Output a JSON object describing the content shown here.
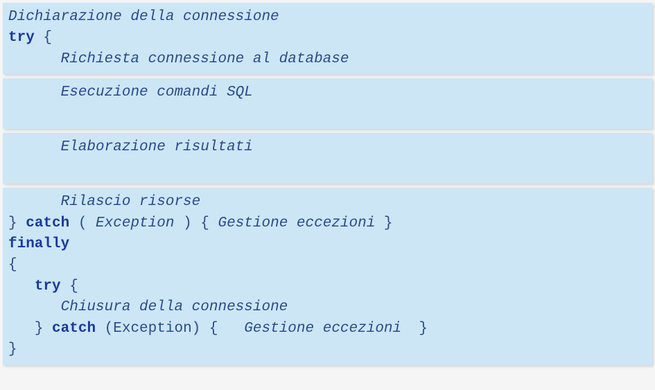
{
  "blocks": [
    {
      "lines": [
        {
          "indent": 0,
          "segments": [
            {
              "style": "comment",
              "text": "Dichiarazione della connessione"
            }
          ]
        },
        {
          "indent": 0,
          "segments": [
            {
              "style": "kw",
              "text": "try"
            },
            {
              "style": "plain",
              "text": " {"
            }
          ]
        },
        {
          "indent": 6,
          "segments": [
            {
              "style": "comment",
              "text": "Richiesta connessione al database"
            }
          ]
        }
      ]
    },
    {
      "lines": [
        {
          "indent": 6,
          "segments": [
            {
              "style": "comment",
              "text": "Esecuzione comandi SQL"
            }
          ]
        },
        {
          "indent": 0,
          "segments": [
            {
              "style": "plain",
              "text": " "
            }
          ]
        }
      ]
    },
    {
      "lines": [
        {
          "indent": 6,
          "segments": [
            {
              "style": "comment",
              "text": "Elaborazione risultati"
            }
          ]
        },
        {
          "indent": 0,
          "segments": [
            {
              "style": "plain",
              "text": " "
            }
          ]
        }
      ]
    },
    {
      "lines": [
        {
          "indent": 6,
          "segments": [
            {
              "style": "comment",
              "text": "Rilascio risorse"
            }
          ]
        },
        {
          "indent": 0,
          "segments": [
            {
              "style": "plain",
              "text": "} "
            },
            {
              "style": "kw",
              "text": "catch"
            },
            {
              "style": "plain",
              "text": " ( "
            },
            {
              "style": "comment",
              "text": "Exception"
            },
            {
              "style": "plain",
              "text": " ) { "
            },
            {
              "style": "comment",
              "text": "Gestione eccezioni"
            },
            {
              "style": "plain",
              "text": " }"
            }
          ]
        },
        {
          "indent": 0,
          "segments": [
            {
              "style": "kw",
              "text": "finally"
            }
          ]
        },
        {
          "indent": 0,
          "segments": [
            {
              "style": "plain",
              "text": "{"
            }
          ]
        },
        {
          "indent": 3,
          "segments": [
            {
              "style": "kw",
              "text": "try"
            },
            {
              "style": "plain",
              "text": " {"
            }
          ]
        },
        {
          "indent": 6,
          "segments": [
            {
              "style": "comment",
              "text": "Chiusura della connessione"
            }
          ]
        },
        {
          "indent": 3,
          "segments": [
            {
              "style": "plain",
              "text": "} "
            },
            {
              "style": "kw",
              "text": "catch"
            },
            {
              "style": "plain",
              "text": " (Exception) {   "
            },
            {
              "style": "comment",
              "text": "Gestione eccezioni"
            },
            {
              "style": "plain",
              "text": "  }"
            }
          ]
        },
        {
          "indent": 0,
          "segments": [
            {
              "style": "plain",
              "text": "}"
            }
          ]
        }
      ]
    }
  ]
}
